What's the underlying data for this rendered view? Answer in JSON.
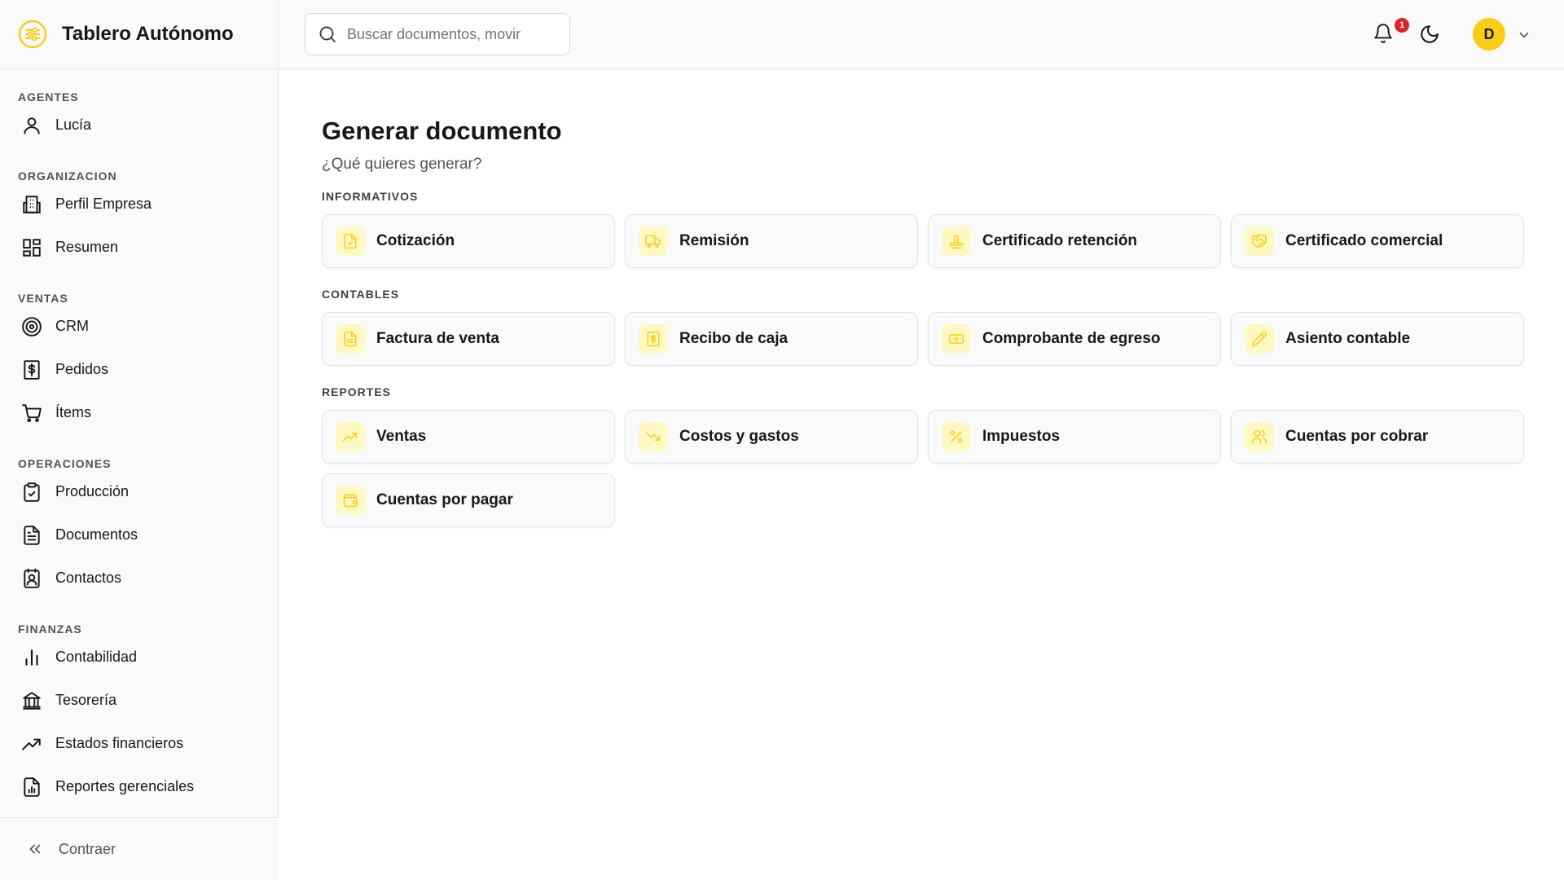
{
  "app": {
    "title": "Tablero Autónomo",
    "logo_icon": "sliders-icon",
    "accent": "#facc15"
  },
  "sidebar": {
    "sections": [
      {
        "title": "AGENTES",
        "items": [
          {
            "label": "Lucía",
            "icon": "user-icon"
          }
        ]
      },
      {
        "title": "ORGANIZACION",
        "items": [
          {
            "label": "Perfil Empresa",
            "icon": "building-icon"
          },
          {
            "label": "Resumen",
            "icon": "layout-grid-icon"
          }
        ]
      },
      {
        "title": "VENTAS",
        "items": [
          {
            "label": "CRM",
            "icon": "target-icon"
          },
          {
            "label": "Pedidos",
            "icon": "dollar-receipt-icon"
          },
          {
            "label": "Ítems",
            "icon": "cart-icon"
          }
        ]
      },
      {
        "title": "OPERACIONES",
        "items": [
          {
            "label": "Producción",
            "icon": "clipboard-check-icon"
          },
          {
            "label": "Documentos",
            "icon": "file-text-icon"
          },
          {
            "label": "Contactos",
            "icon": "contact-icon"
          }
        ]
      },
      {
        "title": "FINANZAS",
        "items": [
          {
            "label": "Contabilidad",
            "icon": "bar-chart-icon"
          },
          {
            "label": "Tesorería",
            "icon": "bank-icon"
          },
          {
            "label": "Estados financieros",
            "icon": "trending-up-icon"
          },
          {
            "label": "Reportes gerenciales",
            "icon": "file-chart-icon"
          }
        ]
      }
    ],
    "collapse_label": "Contraer"
  },
  "topbar": {
    "search_placeholder": "Buscar documentos, movir",
    "notification_count": "1",
    "avatar_initial": "D"
  },
  "main": {
    "title": "Generar documento",
    "subtitle": "¿Qué quieres generar?",
    "groups": [
      {
        "title": "INFORMATIVOS",
        "items": [
          {
            "label": "Cotización",
            "icon": "file-check-icon"
          },
          {
            "label": "Remisión",
            "icon": "truck-icon"
          },
          {
            "label": "Certificado retención",
            "icon": "stamp-icon"
          },
          {
            "label": "Certificado comercial",
            "icon": "handshake-icon"
          }
        ]
      },
      {
        "title": "CONTABLES",
        "items": [
          {
            "label": "Factura de venta",
            "icon": "invoice-icon"
          },
          {
            "label": "Recibo de caja",
            "icon": "receipt-icon"
          },
          {
            "label": "Comprobante de egreso",
            "icon": "banknote-icon"
          },
          {
            "label": "Asiento contable",
            "icon": "pencil-icon"
          }
        ]
      },
      {
        "title": "REPORTES",
        "items": [
          {
            "label": "Ventas",
            "icon": "trending-up-icon"
          },
          {
            "label": "Costos y gastos",
            "icon": "trending-down-icon"
          },
          {
            "label": "Impuestos",
            "icon": "percent-icon"
          },
          {
            "label": "Cuentas por cobrar",
            "icon": "users-icon"
          },
          {
            "label": "Cuentas por pagar",
            "icon": "wallet-icon"
          }
        ]
      }
    ]
  }
}
